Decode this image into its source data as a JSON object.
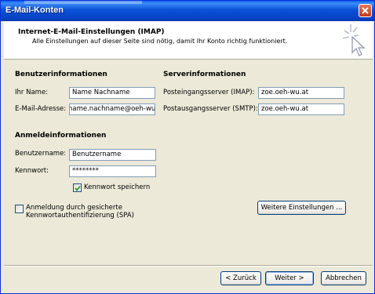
{
  "window": {
    "title": "E-Mail-Konten"
  },
  "header": {
    "title": "Internet-E-Mail-Einstellungen (IMAP)",
    "subtitle": "Alle Einstellungen auf dieser Seite sind nötig, damit Ihr Konto richtig funktioniert."
  },
  "user_info": {
    "heading": "Benutzerinformationen",
    "name_label": "Ihr Name:",
    "name_value": "Name Nachname",
    "email_label": "E-Mail-Adresse:",
    "email_value": "name.nachname@oeh-wu.at"
  },
  "server_info": {
    "heading": "Serverinformationen",
    "incoming_label": "Posteingangsserver (IMAP):",
    "incoming_value": "zoe.oeh-wu.at",
    "outgoing_label": "Postausgangsserver (SMTP):",
    "outgoing_value": "zoe.oeh-wu.at"
  },
  "login_info": {
    "heading": "Anmeldeinformationen",
    "username_label": "Benutzername:",
    "username_value": "Benutzername",
    "password_label": "Kennwort:",
    "password_value": "********",
    "remember_label": "Kennwort speichern",
    "remember_checked": true
  },
  "spa": {
    "label_line1": "Anmeldung durch gesicherte",
    "label_line2": "Kennwortauthentifizierung (SPA)",
    "checked": false
  },
  "buttons": {
    "more_settings": "Weitere Einstellungen ...",
    "back": "< Zurück",
    "next": "Weiter >",
    "cancel": "Abbrechen"
  },
  "icons": {
    "close": "close-icon",
    "wizard": "sparkle-cursor-icon",
    "check": "check-icon"
  }
}
